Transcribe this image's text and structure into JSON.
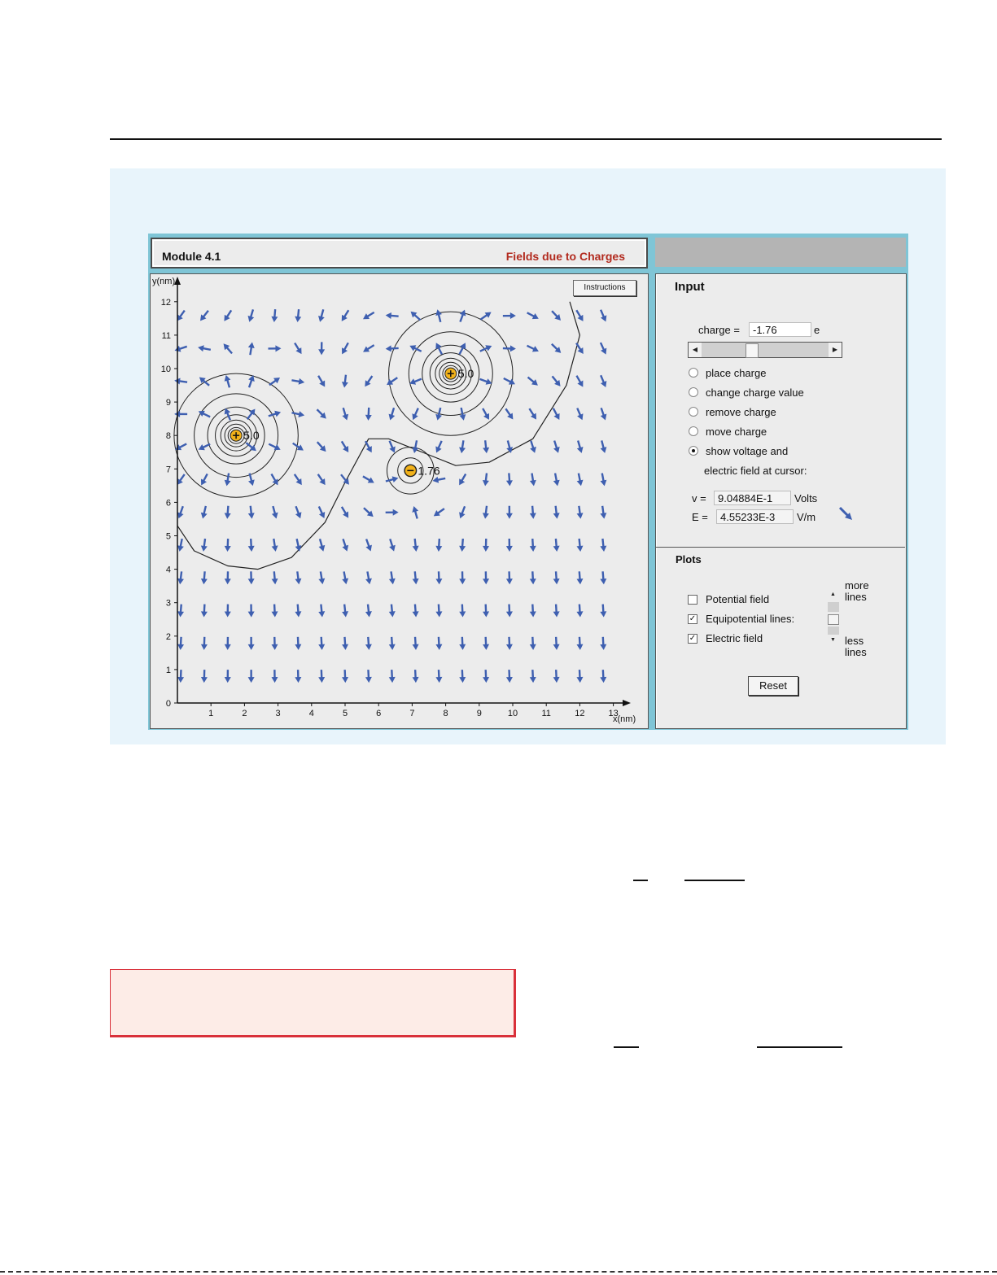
{
  "header": {
    "module": "Module 4.1",
    "title": "Fields due to Charges"
  },
  "plot": {
    "instructions_label": "Instructions",
    "y_axis_label": "y(nm)",
    "x_axis_label": "x(nm)",
    "x_ticks": [
      "1",
      "2",
      "3",
      "4",
      "5",
      "6",
      "7",
      "8",
      "9",
      "10",
      "11",
      "12",
      "13"
    ],
    "y_ticks": [
      "0",
      "1",
      "2",
      "3",
      "4",
      "5",
      "6",
      "7",
      "8",
      "9",
      "10",
      "11",
      "12"
    ],
    "charges": [
      {
        "x": 1.75,
        "y": 8.0,
        "label": "5.0",
        "sign": "+"
      },
      {
        "x": 8.15,
        "y": 9.85,
        "label": "5.0",
        "sign": "+"
      },
      {
        "x": 6.95,
        "y": 6.95,
        "label": "1.76",
        "sign": "-"
      }
    ],
    "arrow_color": "#3e5fb0",
    "charge_color": "#f2b21a"
  },
  "input": {
    "heading": "Input",
    "charge_label": "charge =",
    "charge_value": "-1.76",
    "charge_unit": "e",
    "slider_position": 0.38,
    "options": [
      {
        "label": "place charge",
        "selected": false
      },
      {
        "label": "change charge value",
        "selected": false
      },
      {
        "label": "remove charge",
        "selected": false
      },
      {
        "label": "move charge",
        "selected": false
      },
      {
        "label": "show voltage and",
        "selected": true
      }
    ],
    "option_continuation": "electric field at cursor:",
    "v_label": "v =",
    "v_value": "9.04884E-1",
    "v_unit": "Volts",
    "e_label": "E =",
    "e_value": "4.55233E-3",
    "e_unit": "V/m"
  },
  "plots": {
    "heading": "Plots",
    "items": [
      {
        "label": "Potential field",
        "checked": false
      },
      {
        "label": "Equipotential lines:",
        "checked": true
      },
      {
        "label": "Electric field",
        "checked": true
      }
    ],
    "more_lines": "more lines",
    "less_lines": "less lines",
    "reset_label": "Reset"
  }
}
